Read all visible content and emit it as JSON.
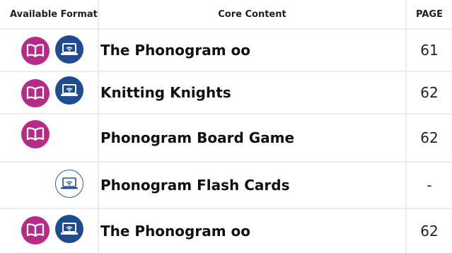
{
  "header": {
    "formats": "Available Format",
    "content": "Core Content",
    "page": "PAGE"
  },
  "rows": [
    {
      "title": "The Phonogram oo",
      "page": "61",
      "formats": [
        "book-icon",
        "laptop-wifi-icon"
      ]
    },
    {
      "title": "Knitting Knights",
      "page": "62",
      "formats": [
        "book-icon",
        "laptop-wifi-icon"
      ]
    },
    {
      "title": "Phonogram Board Game",
      "page": "62",
      "formats": [
        "book-icon"
      ]
    },
    {
      "title": "Phonogram Flash Cards",
      "page": "-",
      "formats": [
        "laptop-wifi-icon"
      ]
    },
    {
      "title": "The Phonogram oo",
      "page": "62",
      "formats": [
        "book-icon",
        "laptop-wifi-icon"
      ]
    }
  ],
  "colors": {
    "book": "#b42c87",
    "laptop": "#1f4c91",
    "divider": "#ececec"
  }
}
